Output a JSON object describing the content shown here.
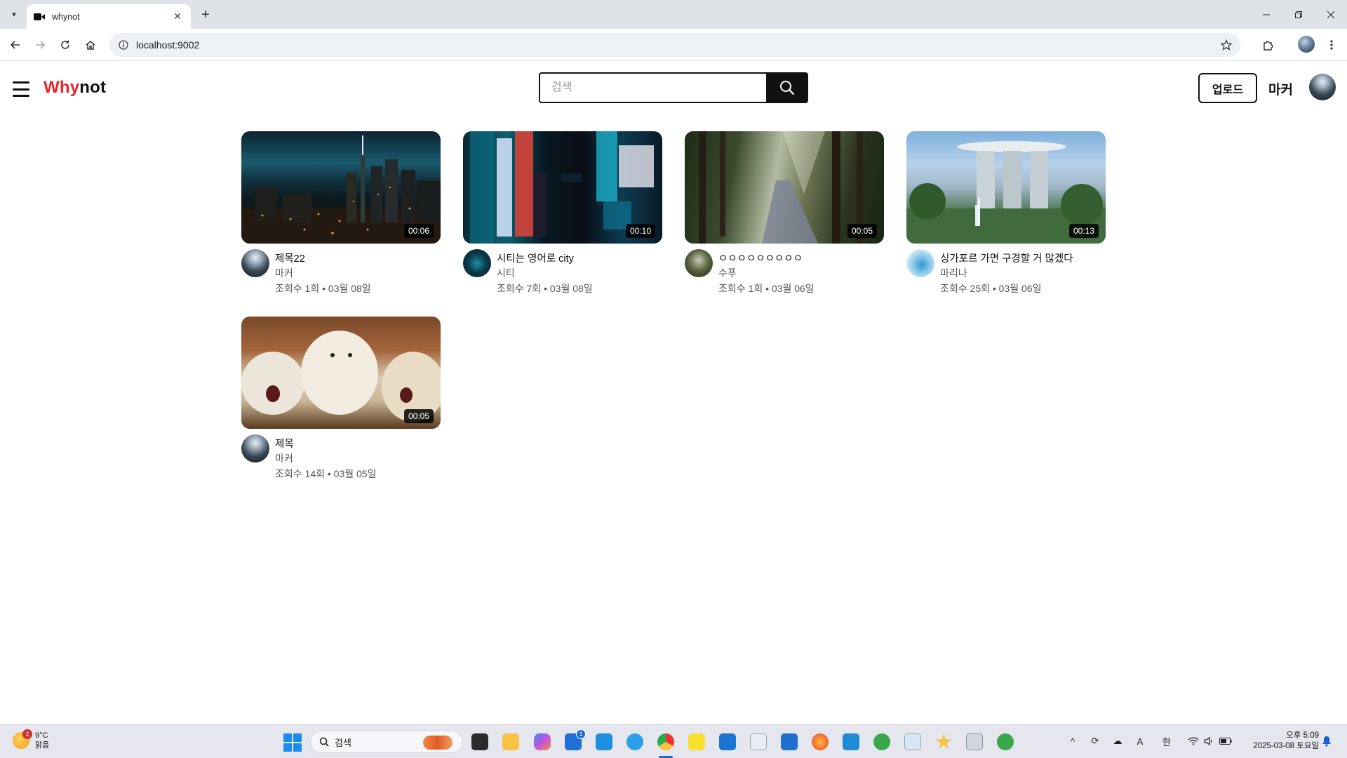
{
  "browser": {
    "tab_title": "whynot",
    "url": "localhost:9002"
  },
  "header": {
    "logo_part1": "Why",
    "logo_part2": "not",
    "search_placeholder": "검색",
    "upload_label": "업로드",
    "username": "마커",
    "colors": {
      "brand": "#e4242a",
      "ink": "#111111"
    }
  },
  "videos": [
    {
      "title": "제목22",
      "channel": "마커",
      "views": "조회수 1회",
      "date": "03월 08일",
      "duration": "00:06",
      "thumbnail": "city-night-skyline"
    },
    {
      "title": "시티는 영어로 city",
      "channel": "시티",
      "views": "조회수 7회",
      "date": "03월 08일",
      "duration": "00:10",
      "thumbnail": "neon-street-signs"
    },
    {
      "title": "ㅇㅇㅇㅇㅇㅇㅇㅇㅇ",
      "channel": "수푸",
      "views": "조회수 1회",
      "date": "03월 06일",
      "duration": "00:05",
      "thumbnail": "forest-path"
    },
    {
      "title": "싱가포르 가면 구경할 거 많겠다",
      "channel": "마리나",
      "views": "조회수 25회",
      "date": "03월 06일",
      "duration": "00:13",
      "thumbnail": "marina-bay-sands"
    },
    {
      "title": "제목",
      "channel": "마커",
      "views": "조회수 14회",
      "date": "03월 05일",
      "duration": "00:05",
      "thumbnail": "white-wolves"
    }
  ],
  "stats_separator": "•",
  "taskbar": {
    "temperature": "9°C",
    "weather": "맑음",
    "weather_badge": "2",
    "search_label": "검색",
    "time": "오후 5:09",
    "date": "2025-03-08 토요일",
    "ime_lang": "한",
    "ime_mode": "A",
    "store_badge": "1"
  }
}
